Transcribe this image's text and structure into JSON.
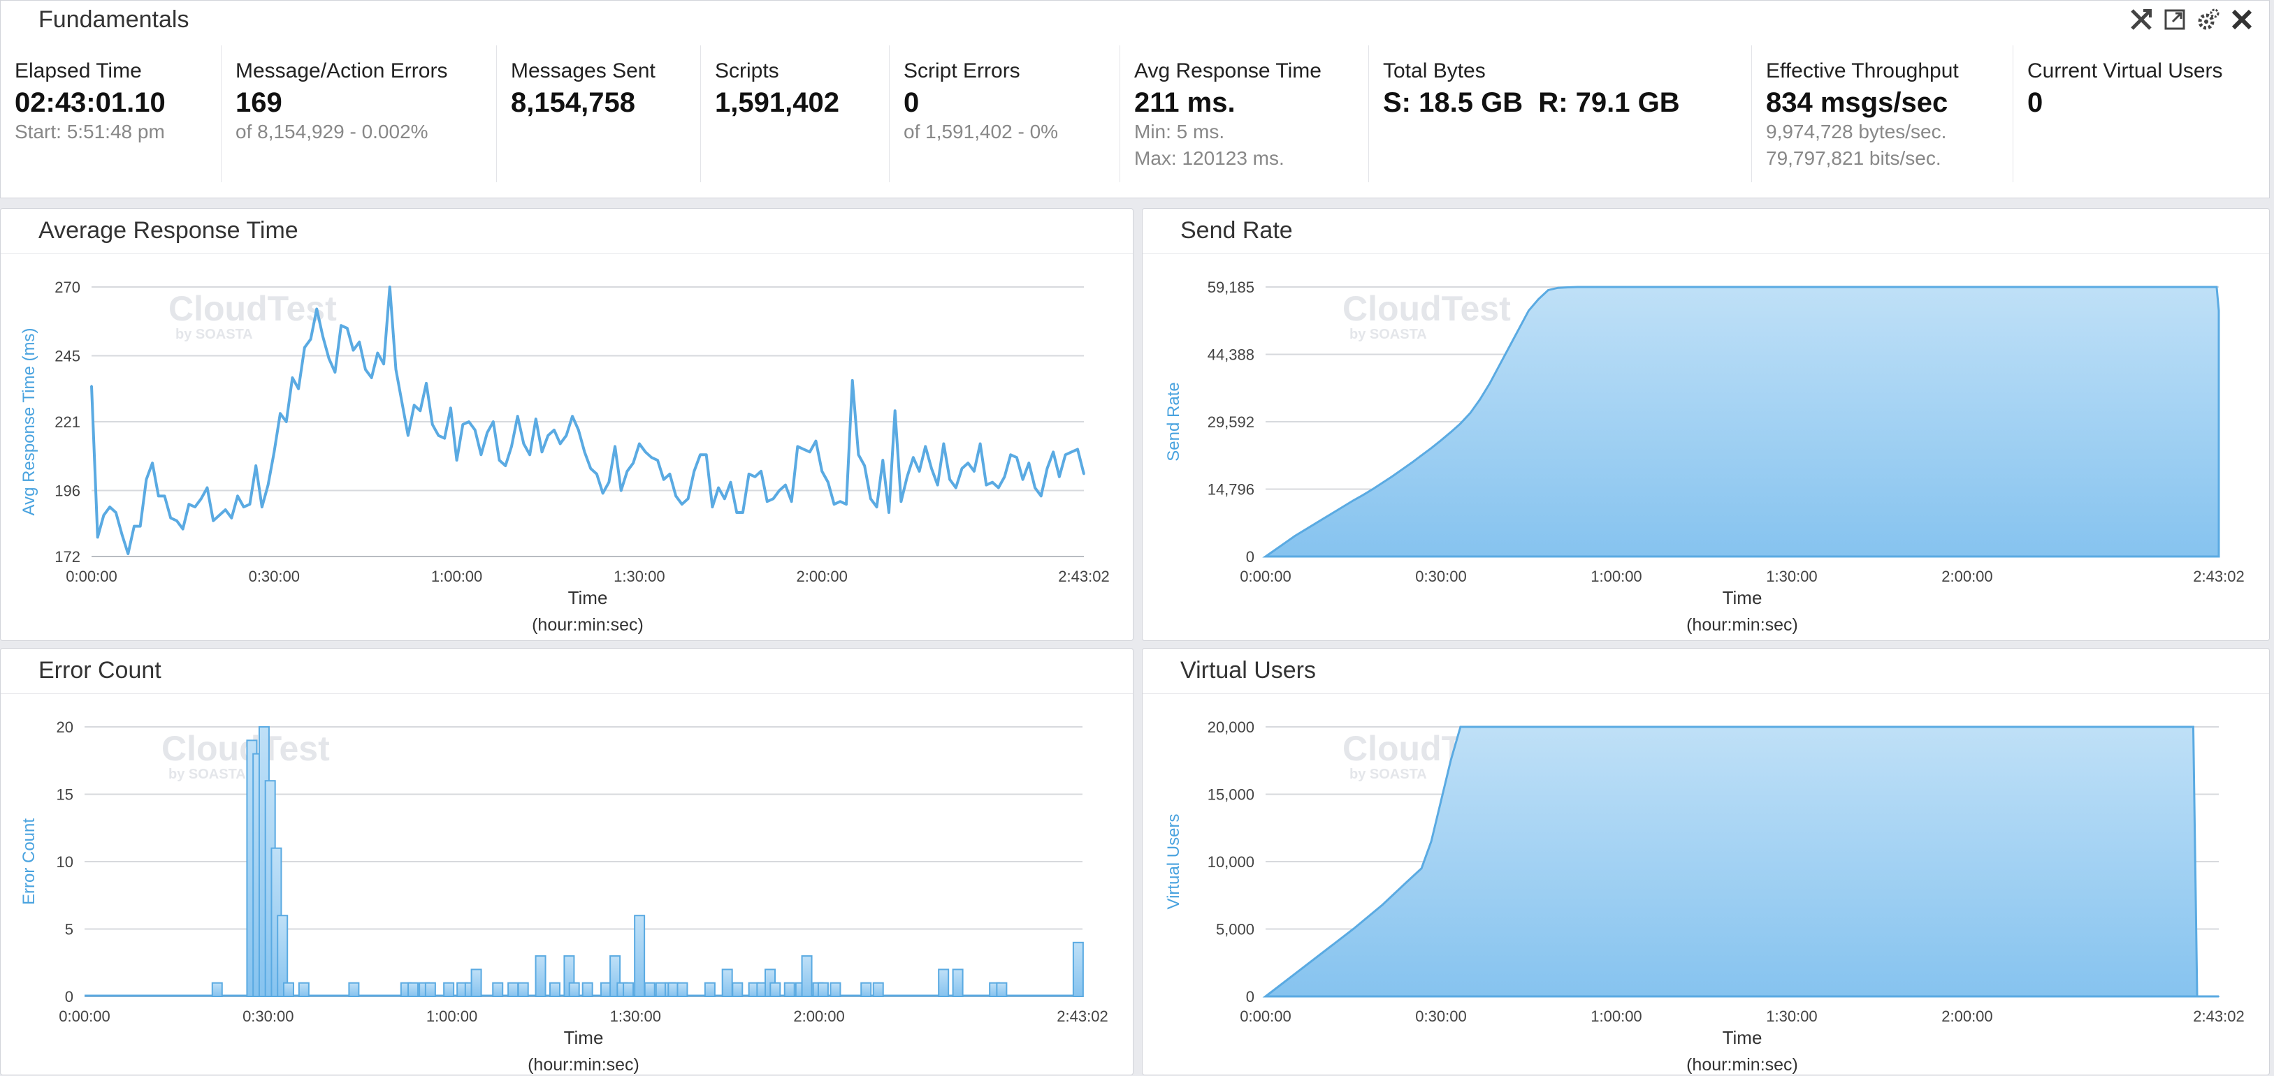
{
  "header": {
    "title": "Fundamentals",
    "icons": [
      "collapse-icon",
      "maximize-icon",
      "settings-icon",
      "close-icon"
    ]
  },
  "metrics": [
    {
      "label": "Elapsed Time",
      "value": "02:43:01.10",
      "sub1": "Start: 5:51:48 pm",
      "sub2": ""
    },
    {
      "label": "Message/Action Errors",
      "value": "169",
      "sub1": "of 8,154,929 - 0.002%",
      "sub2": ""
    },
    {
      "label": "Messages Sent",
      "value": "8,154,758",
      "sub1": "",
      "sub2": ""
    },
    {
      "label": "Scripts",
      "value": "1,591,402",
      "sub1": "",
      "sub2": ""
    },
    {
      "label": "Script Errors",
      "value": "0",
      "sub1": "of 1,591,402 - 0%",
      "sub2": ""
    },
    {
      "label": "Avg Response Time",
      "value": "211 ms.",
      "sub1": "Min: 5 ms.",
      "sub2": "Max: 120123 ms."
    },
    {
      "label": "Total Bytes",
      "value": "S: 18.5 GB  R: 79.1 GB",
      "sub1": "",
      "sub2": ""
    },
    {
      "label": "Effective Throughput",
      "value": "834 msgs/sec",
      "sub1": "9,974,728 bytes/sec.",
      "sub2": "79,797,821 bits/sec."
    },
    {
      "label": "Current Virtual Users",
      "value": "0",
      "sub1": "",
      "sub2": ""
    }
  ],
  "colors": {
    "line": "#5aaae2",
    "fill_top": "#bfe0f7",
    "fill_bottom": "#86c3ef",
    "grid": "#d7d9dd",
    "axis_label": "#4aa3df",
    "watermark": "#e4e6ea"
  },
  "watermark": {
    "main": "CloudTest",
    "sub": "by SOASTA"
  },
  "chart_data": [
    {
      "id": "avg-response-time",
      "title": "Average Response Time",
      "type": "line",
      "ylabel": "Avg Response Time (ms)",
      "xlabel": "Time",
      "xlabel2": "(hour:min:sec)",
      "xlim": [
        0,
        9782
      ],
      "ylim": [
        172,
        270
      ],
      "yticks": [
        172,
        196,
        221,
        245,
        270
      ],
      "ytick_labels": [
        "172",
        "196",
        "221",
        "245",
        "270"
      ],
      "xticks": [
        0,
        1800,
        3600,
        5400,
        7200,
        9782
      ],
      "xtick_labels": [
        "0:00:00",
        "0:30:00",
        "1:00:00",
        "1:30:00",
        "2:00:00",
        "2:43:02"
      ],
      "x": [
        0,
        60,
        120,
        180,
        240,
        300,
        360,
        420,
        480,
        540,
        600,
        660,
        720,
        780,
        840,
        900,
        960,
        1020,
        1080,
        1140,
        1200,
        1260,
        1320,
        1380,
        1440,
        1500,
        1560,
        1620,
        1680,
        1740,
        1800,
        1860,
        1920,
        1980,
        2040,
        2100,
        2160,
        2220,
        2280,
        2340,
        2400,
        2460,
        2520,
        2580,
        2640,
        2700,
        2760,
        2820,
        2880,
        2940,
        3000,
        3060,
        3120,
        3180,
        3240,
        3300,
        3360,
        3420,
        3480,
        3540,
        3600,
        3660,
        3720,
        3780,
        3840,
        3900,
        3960,
        4020,
        4080,
        4140,
        4200,
        4260,
        4320,
        4380,
        4440,
        4500,
        4560,
        4620,
        4680,
        4740,
        4800,
        4860,
        4920,
        4980,
        5040,
        5100,
        5160,
        5220,
        5280,
        5340,
        5400,
        5460,
        5520,
        5580,
        5640,
        5700,
        5760,
        5820,
        5880,
        5940,
        6000,
        6060,
        6120,
        6180,
        6240,
        6300,
        6360,
        6420,
        6480,
        6540,
        6600,
        6660,
        6720,
        6780,
        6840,
        6900,
        6960,
        7020,
        7080,
        7140,
        7200,
        7260,
        7320,
        7380,
        7440,
        7500,
        7560,
        7620,
        7680,
        7740,
        7800,
        7860,
        7920,
        7980,
        8040,
        8100,
        8160,
        8220,
        8280,
        8340,
        8400,
        8460,
        8520,
        8580,
        8640,
        8700,
        8760,
        8820,
        8880,
        8940,
        9000,
        9060,
        9120,
        9180,
        9240,
        9300,
        9360,
        9420,
        9480,
        9540,
        9600,
        9660,
        9720,
        9782
      ],
      "y": [
        234,
        179,
        187,
        190,
        188,
        180,
        173,
        183,
        183,
        200,
        206,
        194,
        194,
        186,
        185,
        182,
        191,
        190,
        193,
        197,
        185,
        187,
        189,
        186,
        194,
        190,
        191,
        205,
        190,
        198,
        210,
        224,
        221,
        237,
        233,
        248,
        251,
        262,
        252,
        244,
        239,
        256,
        255,
        247,
        250,
        240,
        237,
        246,
        242,
        270,
        240,
        228,
        216,
        227,
        225,
        235,
        220,
        216,
        215,
        226,
        207,
        220,
        221,
        218,
        209,
        217,
        221,
        207,
        205,
        212,
        223,
        213,
        209,
        222,
        210,
        216,
        218,
        213,
        216,
        223,
        218,
        210,
        204,
        202,
        195,
        199,
        212,
        196,
        203,
        206,
        213,
        210,
        208,
        207,
        200,
        202,
        194,
        191,
        193,
        203,
        209,
        209,
        190,
        197,
        193,
        199,
        188,
        188,
        202,
        201,
        203,
        192,
        193,
        196,
        198,
        192,
        212,
        211,
        210,
        214,
        203,
        199,
        191,
        192,
        191,
        236,
        209,
        205,
        193,
        190,
        207,
        188,
        225,
        192,
        201,
        208,
        203,
        212,
        204,
        198,
        213,
        200,
        197,
        204,
        206,
        203,
        213,
        198,
        199,
        197,
        201,
        209,
        208,
        200,
        206,
        197,
        194,
        204,
        210,
        201,
        209,
        210,
        211,
        202,
        202,
        197,
        202,
        215,
        213,
        207,
        201,
        205,
        210,
        210,
        199,
        201,
        206,
        213,
        211,
        208,
        211,
        199,
        196,
        196,
        202,
        211,
        211,
        208,
        212,
        206,
        209,
        198
      ]
    },
    {
      "id": "send-rate",
      "title": "Send Rate",
      "type": "area",
      "ylabel": "Send Rate",
      "xlabel": "Time",
      "xlabel2": "(hour:min:sec)",
      "xlim": [
        0,
        9782
      ],
      "ylim": [
        0,
        59185
      ],
      "yticks": [
        0,
        14796,
        29592,
        44388,
        59185
      ],
      "ytick_labels": [
        "0",
        "14,796",
        "29,592",
        "44,388",
        "59,185"
      ],
      "xticks": [
        0,
        1800,
        3600,
        5400,
        7200,
        9782
      ],
      "xtick_labels": [
        "0:00:00",
        "0:30:00",
        "1:00:00",
        "1:30:00",
        "2:00:00",
        "2:43:02"
      ],
      "x": [
        0,
        100,
        200,
        300,
        400,
        500,
        600,
        700,
        800,
        900,
        1000,
        1100,
        1200,
        1300,
        1400,
        1500,
        1600,
        1700,
        1800,
        1900,
        2000,
        2100,
        2200,
        2300,
        2400,
        2500,
        2600,
        2700,
        2800,
        2900,
        3000,
        3100,
        3200,
        3300,
        3400,
        3500,
        3600,
        3700,
        3800,
        4000,
        4500,
        5000,
        5500,
        6000,
        6500,
        7000,
        7500,
        8000,
        8500,
        9000,
        9500,
        9700,
        9760,
        9782
      ],
      "y": [
        0,
        1500,
        3000,
        4500,
        5800,
        7100,
        8400,
        9700,
        11000,
        12300,
        13500,
        14800,
        16200,
        17600,
        19100,
        20600,
        22200,
        23800,
        25500,
        27300,
        29200,
        31500,
        34500,
        38000,
        42000,
        46000,
        50000,
        54000,
        56500,
        58500,
        59000,
        59100,
        59185,
        59185,
        59185,
        59185,
        59185,
        59185,
        59185,
        59185,
        59185,
        59185,
        59185,
        59185,
        59185,
        59185,
        59185,
        59185,
        59185,
        59185,
        59185,
        59185,
        59185,
        54000
      ]
    },
    {
      "id": "error-count",
      "title": "Error Count",
      "type": "bar",
      "ylabel": "Error Count",
      "xlabel": "Time",
      "xlabel2": "(hour:min:sec)",
      "xlim": [
        0,
        9782
      ],
      "ylim": [
        0,
        20
      ],
      "yticks": [
        0,
        5,
        10,
        15,
        20
      ],
      "ytick_labels": [
        "0",
        "5",
        "10",
        "15",
        "20"
      ],
      "xticks": [
        0,
        1800,
        3600,
        5400,
        7200,
        9782
      ],
      "xtick_labels": [
        "0:00:00",
        "0:30:00",
        "1:00:00",
        "1:30:00",
        "2:00:00",
        "2:43:02"
      ],
      "x": [
        1300,
        1640,
        1700,
        1760,
        1820,
        1880,
        1940,
        2000,
        2150,
        2640,
        3150,
        3220,
        3330,
        3390,
        3570,
        3700,
        3780,
        3840,
        4050,
        4200,
        4300,
        4470,
        4610,
        4750,
        4800,
        4930,
        5110,
        5200,
        5270,
        5330,
        5440,
        5540,
        5650,
        5740,
        5770,
        5860,
        6130,
        6300,
        6400,
        6560,
        6640,
        6720,
        6770,
        6910,
        7020,
        7080,
        7190,
        7240,
        7360,
        7660,
        7780,
        8420,
        8560,
        8920,
        8990,
        9740
      ],
      "values": [
        1,
        19,
        18,
        20,
        16,
        11,
        6,
        1,
        1,
        1,
        1,
        1,
        1,
        1,
        1,
        1,
        1,
        2,
        1,
        1,
        1,
        3,
        1,
        3,
        1,
        1,
        1,
        3,
        1,
        1,
        6,
        1,
        1,
        1,
        1,
        1,
        1,
        2,
        1,
        1,
        1,
        2,
        1,
        1,
        1,
        3,
        1,
        1,
        1,
        1,
        1,
        2,
        2,
        1,
        1,
        4
      ]
    },
    {
      "id": "virtual-users",
      "title": "Virtual Users",
      "type": "area",
      "ylabel": "Virtual Users",
      "xlabel": "Time",
      "xlabel2": "(hour:min:sec)",
      "xlim": [
        0,
        9782
      ],
      "ylim": [
        0,
        20000
      ],
      "yticks": [
        0,
        5000,
        10000,
        15000,
        20000
      ],
      "ytick_labels": [
        "0",
        "5,000",
        "10,000",
        "15,000",
        "20,000"
      ],
      "xticks": [
        0,
        1800,
        3600,
        5400,
        7200,
        9782
      ],
      "xtick_labels": [
        "0:00:00",
        "0:30:00",
        "1:00:00",
        "1:30:00",
        "2:00:00",
        "2:43:02"
      ],
      "x": [
        0,
        900,
        1200,
        1450,
        1600,
        1700,
        1800,
        1900,
        2000,
        2100,
        9520,
        9560,
        9782
      ],
      "y": [
        0,
        5000,
        6800,
        8500,
        9500,
        11500,
        14500,
        17500,
        20000,
        20000,
        20000,
        0,
        0
      ]
    }
  ]
}
